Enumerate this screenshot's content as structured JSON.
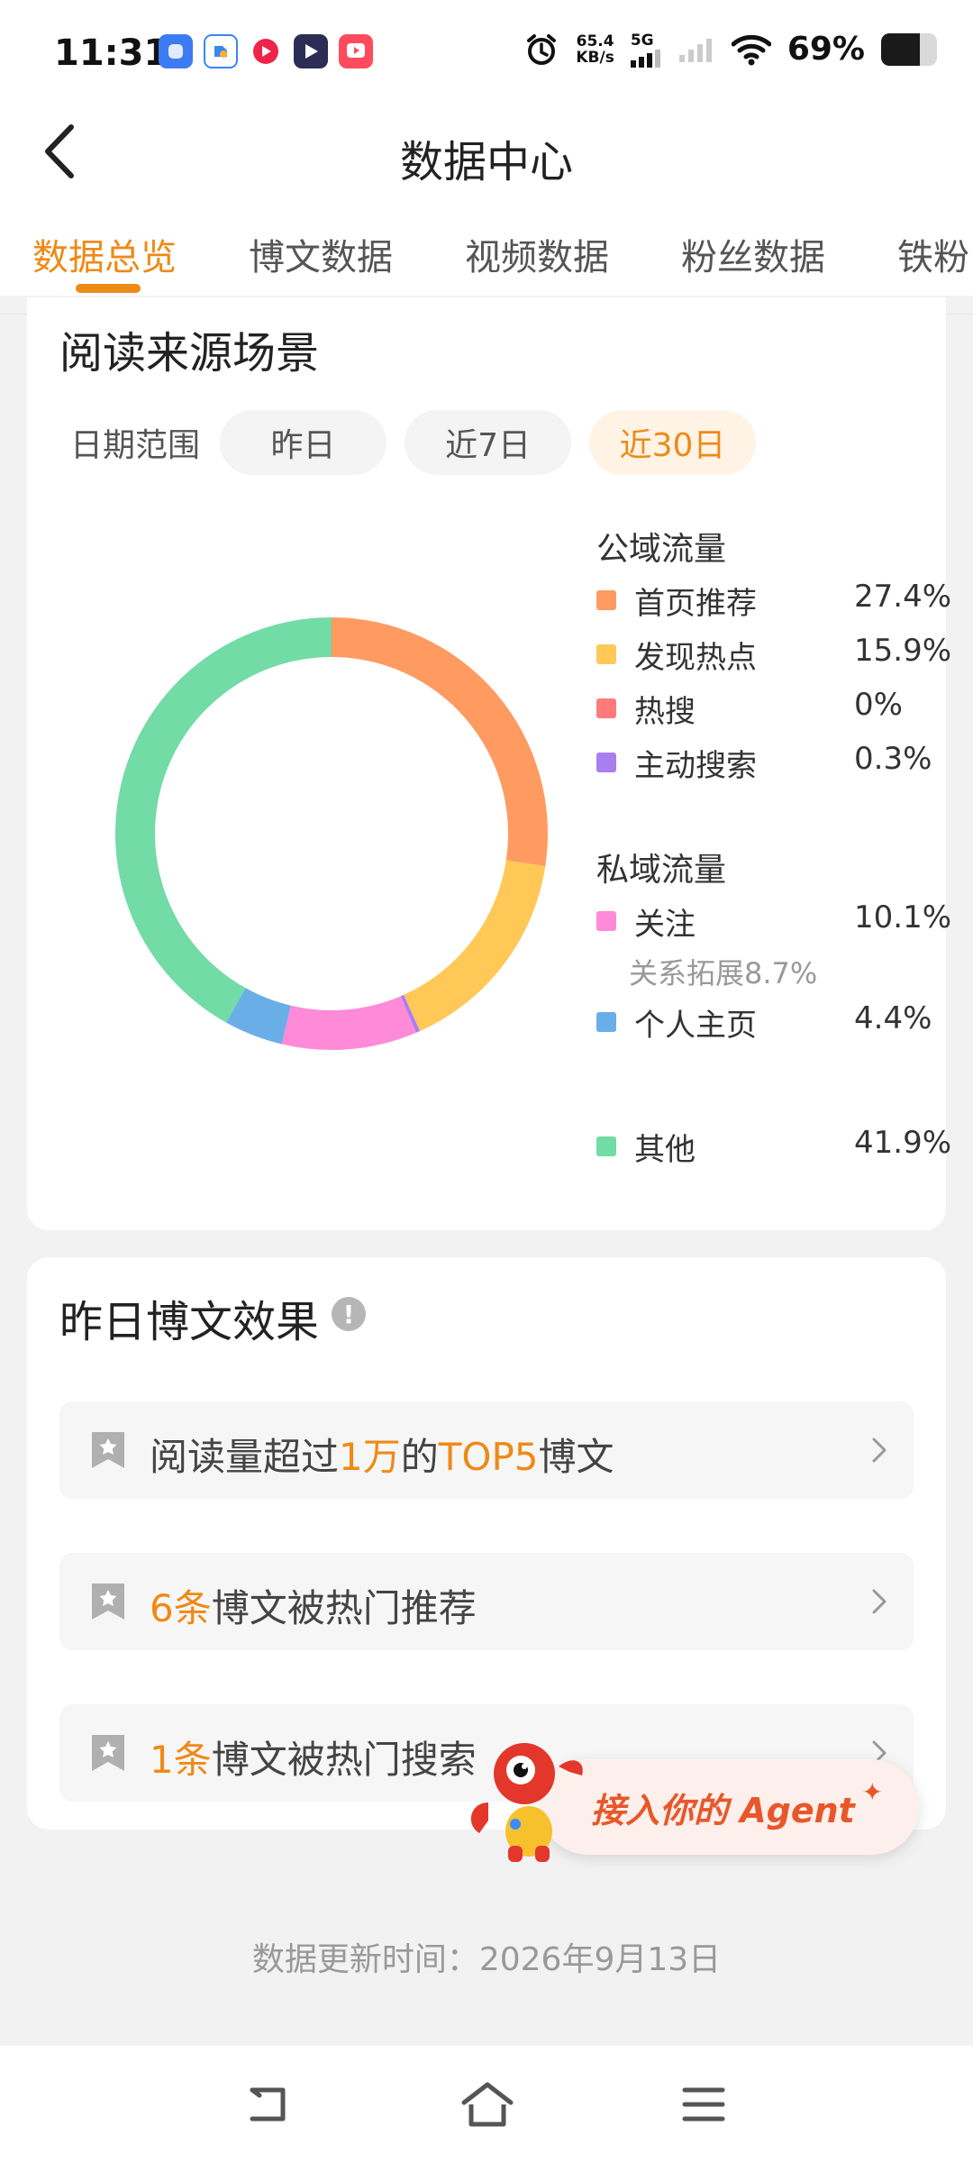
{
  "status_bar": {
    "time": "11:31",
    "net_speed_value": "65.4",
    "net_speed_unit": "KB/s",
    "net_type": "5G",
    "battery_percent": "69%",
    "battery_level": 0.69
  },
  "header": {
    "title": "数据中心",
    "tabs": [
      {
        "label": "数据总览",
        "active": true
      },
      {
        "label": "博文数据",
        "active": false
      },
      {
        "label": "视频数据",
        "active": false
      },
      {
        "label": "粉丝数据",
        "active": false
      },
      {
        "label": "铁粉",
        "active": false
      }
    ]
  },
  "read_source": {
    "title": "阅读来源场景",
    "date_range_label": "日期范围",
    "date_options": [
      {
        "label": "昨日",
        "active": false
      },
      {
        "label": "近7日",
        "active": false
      },
      {
        "label": "近30日",
        "active": true
      }
    ],
    "public_title": "公域流量",
    "private_title": "私域流量",
    "public_items": [
      {
        "name": "首页推荐",
        "value": "27.4%",
        "color": "#ff9b60"
      },
      {
        "name": "发现热点",
        "value": "15.9%",
        "color": "#ffc857"
      },
      {
        "name": "热搜",
        "value": "0%",
        "color": "#ff7b7b"
      },
      {
        "name": "主动搜索",
        "value": "0.3%",
        "color": "#a97ff0"
      }
    ],
    "private_items": [
      {
        "name": "关注",
        "value": "10.1%",
        "color": "#ff8ad8",
        "sub": "关系拓展8.7%"
      },
      {
        "name": "个人主页",
        "value": "4.4%",
        "color": "#6aaee8"
      }
    ],
    "other_item": {
      "name": "其他",
      "value": "41.9%",
      "color": "#72dba6"
    }
  },
  "chart_data": {
    "type": "pie",
    "categories": [
      "首页推荐",
      "发现热点",
      "热搜",
      "主动搜索",
      "关注",
      "个人主页",
      "其他"
    ],
    "values": [
      27.4,
      15.9,
      0,
      0.3,
      10.1,
      4.4,
      41.9
    ],
    "colors": [
      "#ff9b60",
      "#ffc857",
      "#ff7b7b",
      "#a97ff0",
      "#ff8ad8",
      "#6aaee8",
      "#72dba6"
    ],
    "legend": "right"
  },
  "yesterday": {
    "title": "昨日博文效果",
    "info_icon": "info-icon",
    "rows": [
      {
        "pre": "阅读量超过",
        "hl1": "1万",
        "mid": "的",
        "hl2": "TOP5",
        "post": "博文"
      },
      {
        "hl1": "6条",
        "post": "博文被热门推荐"
      },
      {
        "hl1": "1条",
        "post": "博文被热门搜索"
      }
    ]
  },
  "agent_button": {
    "label": "接入你的 Agent"
  },
  "update_time": "数据更新时间：2026年9月13日",
  "nav_bar": {
    "back": "back-nav-icon",
    "home": "home-icon",
    "menu": "menu-icon"
  }
}
